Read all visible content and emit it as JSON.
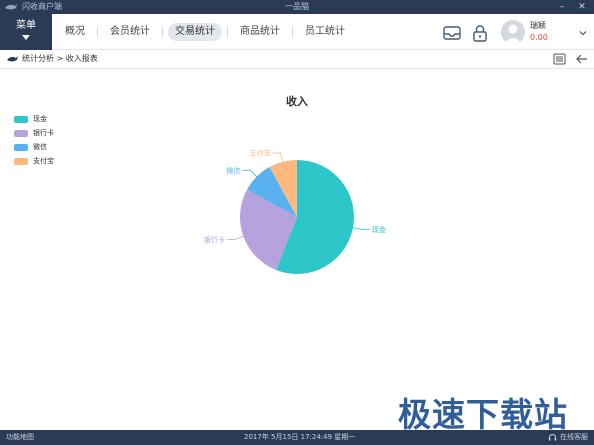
{
  "titlebar": {
    "app_name": "闪收商户端",
    "window_title": "一品猫"
  },
  "menu": {
    "label": "菜单"
  },
  "tabs": [
    {
      "label": "概况",
      "active": false
    },
    {
      "label": "会员统计",
      "active": false
    },
    {
      "label": "交易统计",
      "active": true
    },
    {
      "label": "商品统计",
      "active": false
    },
    {
      "label": "员工统计",
      "active": false
    }
  ],
  "user": {
    "name": "瑞颖",
    "balance": "0.00"
  },
  "breadcrumb": {
    "text": "统计分析 > 收入报表"
  },
  "chart_data": {
    "type": "pie",
    "title": "收入",
    "legend_placement": "top-left",
    "slices": [
      {
        "name": "现金",
        "value": 56,
        "color": "#2ec7c9"
      },
      {
        "name": "银行卡",
        "value": 27,
        "color": "#b6a2de"
      },
      {
        "name": "微信",
        "value": 9,
        "color": "#5ab1ef"
      },
      {
        "name": "支付宝",
        "value": 8,
        "color": "#ffb980"
      }
    ]
  },
  "watermark": "极速下载站",
  "statusbar": {
    "left": "功能地图",
    "center": "2017年 5月15日 17:24:49 星期一",
    "right": "在线客服"
  },
  "icons": {
    "app_logo": "shark-icon",
    "inbox": "inbox-icon",
    "lock": "lock-icon",
    "list": "list-icon",
    "back": "back-arrow-icon",
    "breadcrumb": "shark-icon",
    "headset": "headset-icon"
  }
}
